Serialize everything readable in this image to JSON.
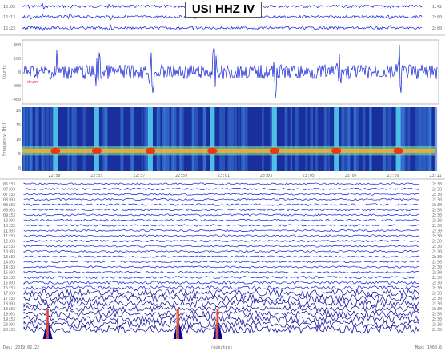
{
  "title": "USI HHZ IV",
  "top_strip": {
    "left_times": [
      "16:03",
      "16:13",
      "16:23"
    ],
    "right_values": [
      "1:42",
      "2:00",
      "2:00"
    ]
  },
  "chart_data": [
    {
      "type": "line",
      "name": "waveform-panel",
      "ylabel": "Counts",
      "yticks": [
        "400",
        "200",
        "0",
        "-200",
        "-400"
      ],
      "xlim": [
        0,
        1
      ],
      "burst_positions": [
        0.08,
        0.18,
        0.31,
        0.46,
        0.61,
        0.76,
        0.91
      ],
      "note_label": "drum"
    },
    {
      "type": "heatmap",
      "name": "spectrogram-panel",
      "ylabel": "Frequency [Hz]",
      "yticks": [
        "20",
        "15",
        "10",
        "5",
        "0"
      ],
      "xticks": [
        "22:50",
        "22:55",
        "22:57",
        "22:59",
        "23:01",
        "23:03",
        "23:05",
        "23:07",
        "23:09",
        "23:11"
      ],
      "band_frequency_hz": 3,
      "burst_positions": [
        0.08,
        0.18,
        0.31,
        0.46,
        0.61,
        0.76,
        0.91
      ]
    },
    {
      "type": "line",
      "name": "helicorder",
      "rows": 29,
      "left_labels": [
        "06:33",
        "07:03",
        "07:33",
        "08:03",
        "08:33",
        "09:03",
        "09:33",
        "10:03",
        "10:33",
        "11:03",
        "11:33",
        "12:03",
        "12:33",
        "13:03",
        "13:33",
        "14:03",
        "14:33",
        "15:03",
        "15:33",
        "16:03",
        "16:33",
        "17:03",
        "17:33",
        "18:03",
        "18:33",
        "19:03",
        "19:33",
        "20:03",
        "20:33"
      ],
      "right_labels": [
        "2:30",
        "2:30",
        "2:30",
        "2:30",
        "2:30",
        "2:30",
        "2:30",
        "2:30",
        "2:30",
        "2:30",
        "2:30",
        "2:30",
        "2:30",
        "2:30",
        "2:30",
        "2:30",
        "2:30",
        "2:30",
        "2:30",
        "2:30",
        "2:30",
        "2:30",
        "2:30",
        "2:30",
        "2:30",
        "2:30",
        "2:30",
        "2:30",
        "2:30"
      ],
      "event_markers": [
        0.06,
        0.39,
        0.49
      ],
      "xlabel": "(minutes)",
      "bottom_left": "Day: 2019.02.22",
      "bottom_right": "Max: 1960.6"
    }
  ],
  "colors": {
    "trace": "#1020d8",
    "trace_dark": "#000099",
    "marker": "#e84040",
    "grid": "#dddddd"
  }
}
